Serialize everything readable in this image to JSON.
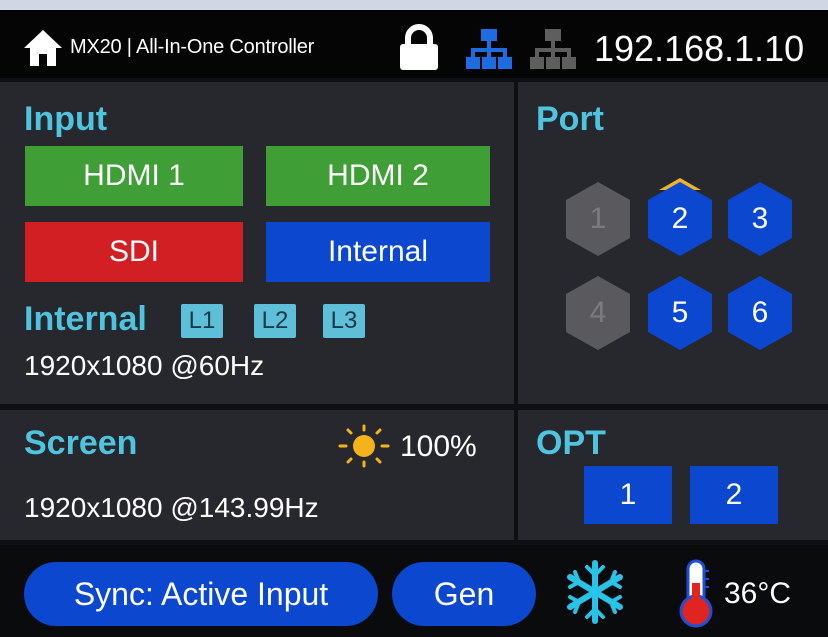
{
  "header": {
    "title": "MX20 | All-In-One Controller",
    "ip": "192.168.1.10",
    "icons": [
      "home-icon",
      "lock-icon",
      "network-active-icon",
      "network-inactive-icon"
    ]
  },
  "input": {
    "heading": "Input",
    "buttons": [
      {
        "label": "HDMI 1",
        "color": "#3f9e36"
      },
      {
        "label": "HDMI 2",
        "color": "#3f9e36"
      },
      {
        "label": "SDI",
        "color": "#d21f24"
      },
      {
        "label": "Internal",
        "color": "#0b47cf"
      }
    ],
    "internal_label": "Internal",
    "layers": [
      "L1",
      "L2",
      "L3"
    ],
    "resolution": "1920x1080 @60Hz"
  },
  "port": {
    "heading": "Port",
    "ports": [
      {
        "label": "1",
        "active": false
      },
      {
        "label": "2",
        "active": true,
        "selected": true
      },
      {
        "label": "3",
        "active": true
      },
      {
        "label": "4",
        "active": false
      },
      {
        "label": "5",
        "active": true
      },
      {
        "label": "6",
        "active": true
      }
    ]
  },
  "screen": {
    "heading": "Screen",
    "brightness": "100%",
    "resolution": "1920x1080 @143.99Hz"
  },
  "opt": {
    "heading": "OPT",
    "buttons": [
      "1",
      "2"
    ]
  },
  "footer": {
    "sync_label": "Sync: Active Input",
    "gen_label": "Gen",
    "temperature": "36°C",
    "icons": [
      "snowflake-icon",
      "thermometer-icon"
    ]
  },
  "colors": {
    "accent": "#4fc4de",
    "green": "#3f9e36",
    "red": "#d21f24",
    "blue": "#0b47cf",
    "panel": "#26282e"
  }
}
